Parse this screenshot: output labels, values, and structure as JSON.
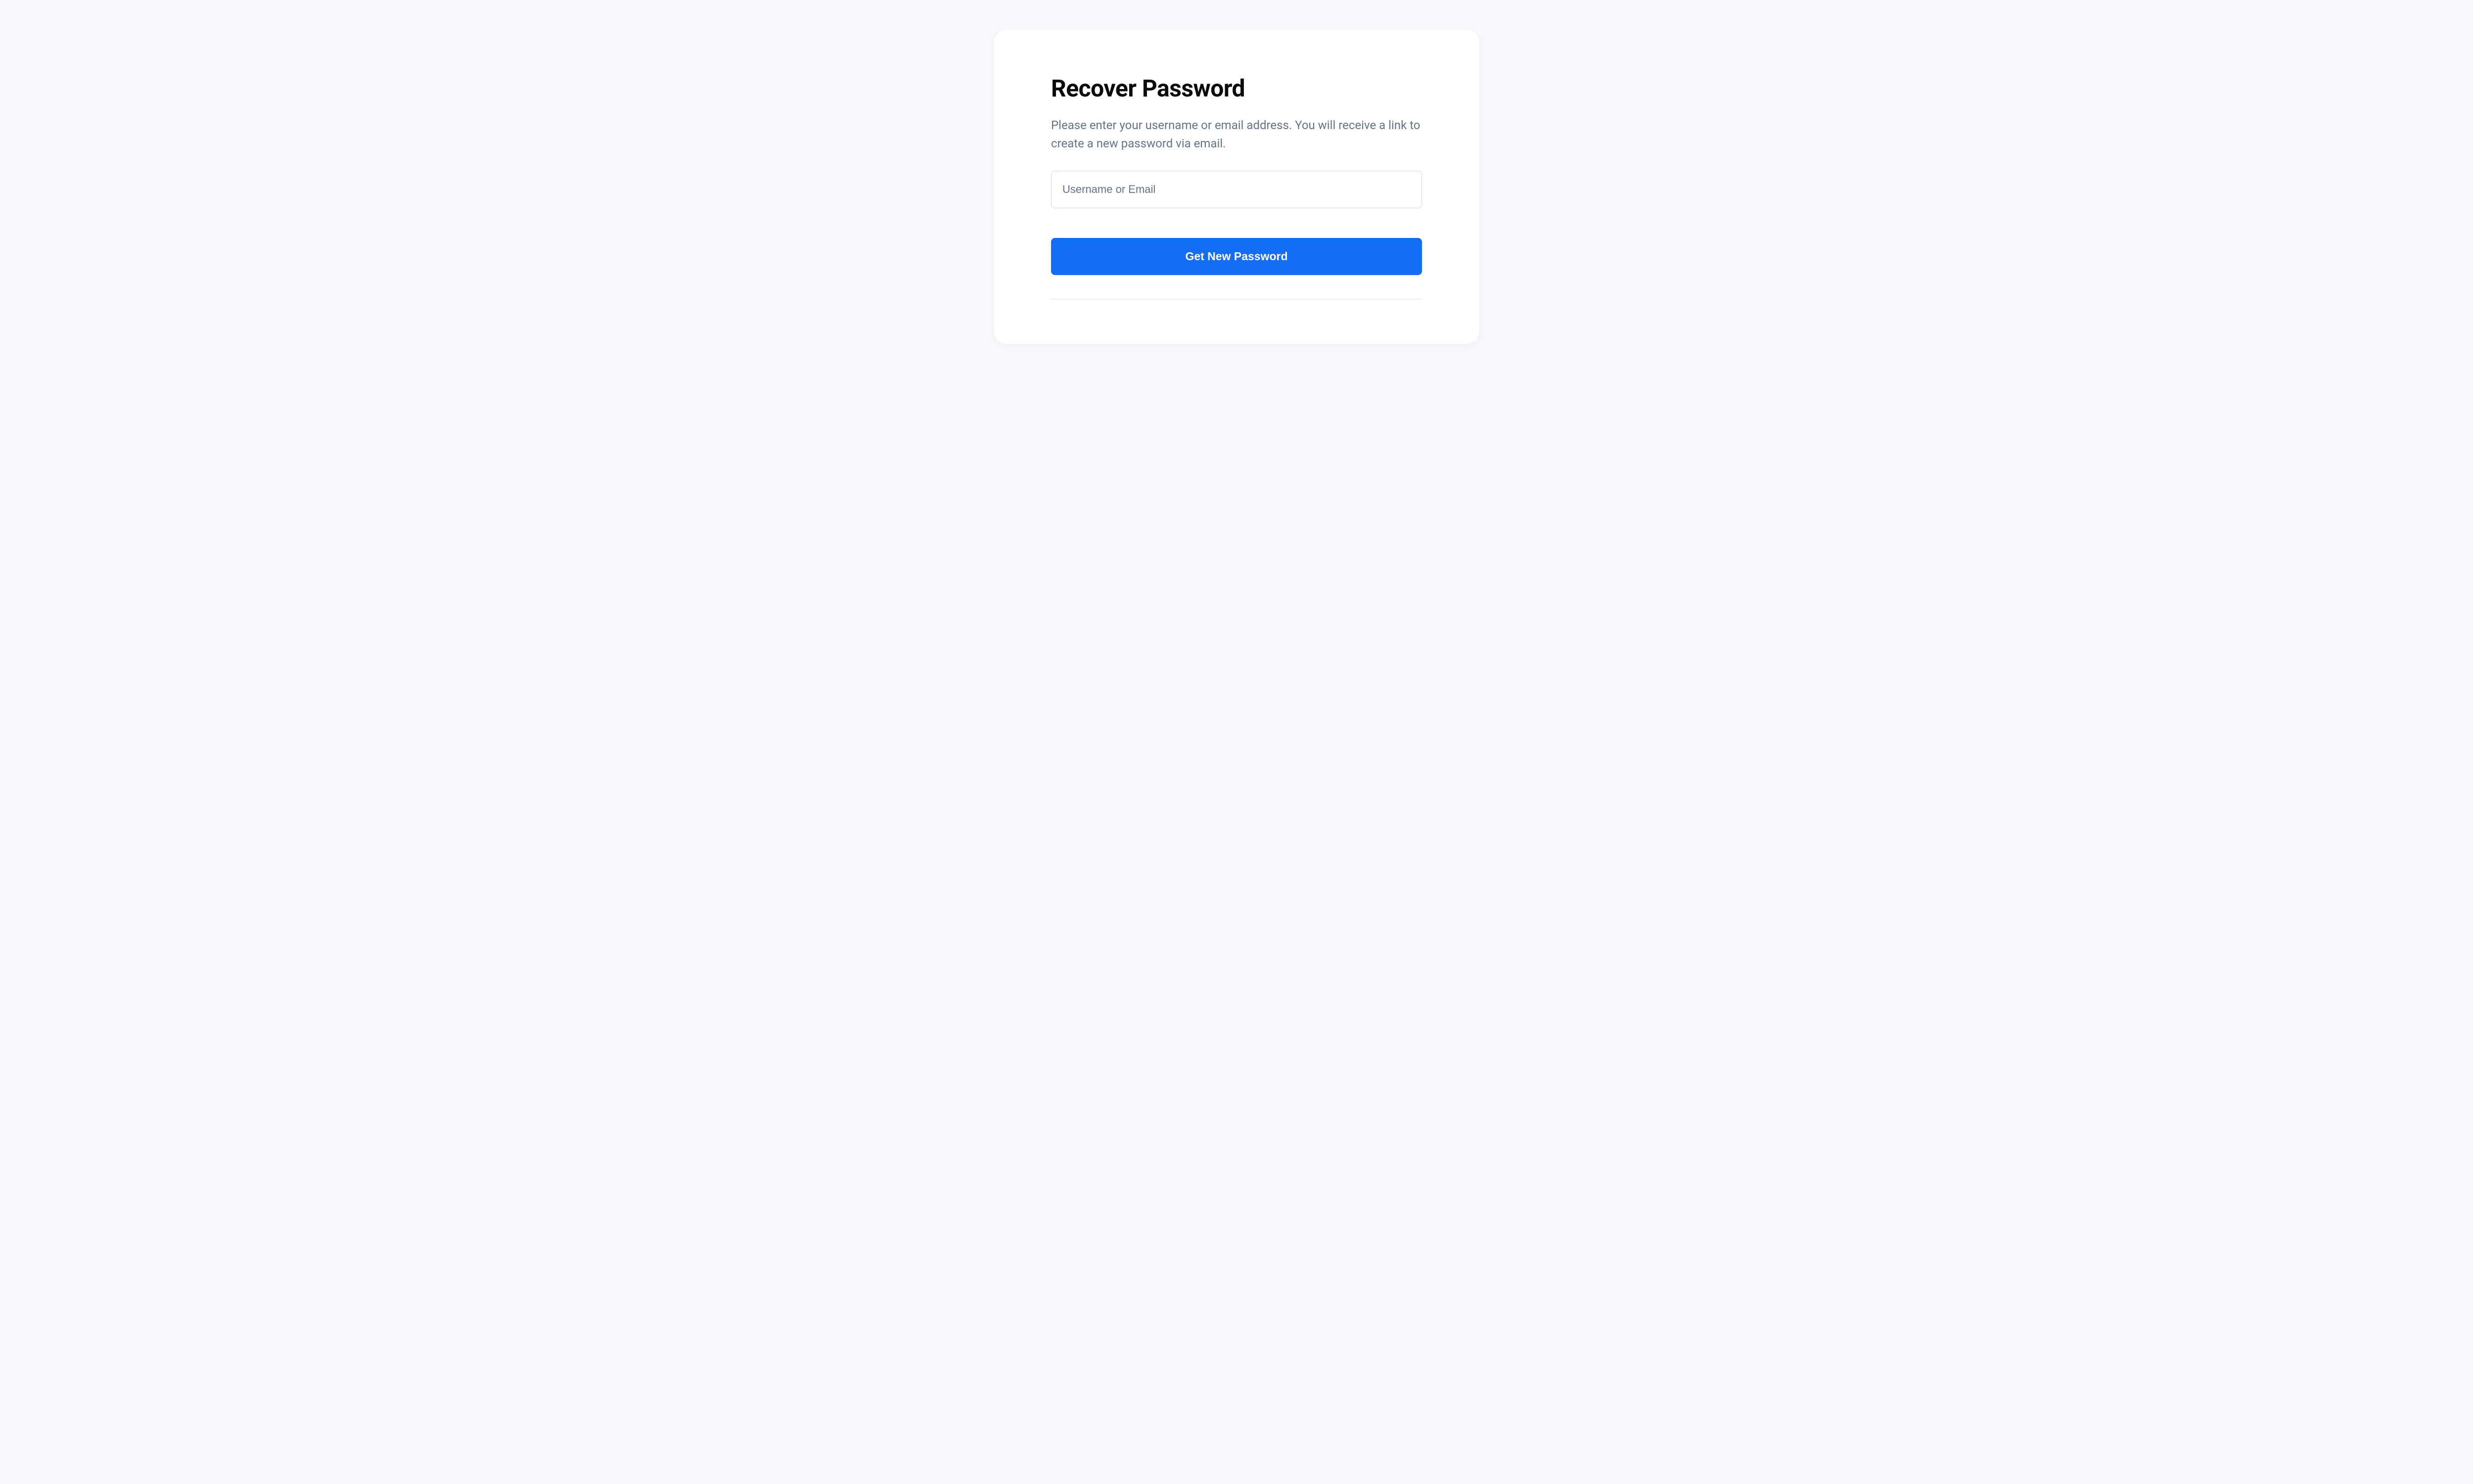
{
  "card": {
    "title": "Recover Password",
    "subtitle": "Please enter your username or email address. You will receive a link to create a new password via email.",
    "input": {
      "placeholder": "Username or Email",
      "value": ""
    },
    "submit_label": "Get New Password"
  }
}
